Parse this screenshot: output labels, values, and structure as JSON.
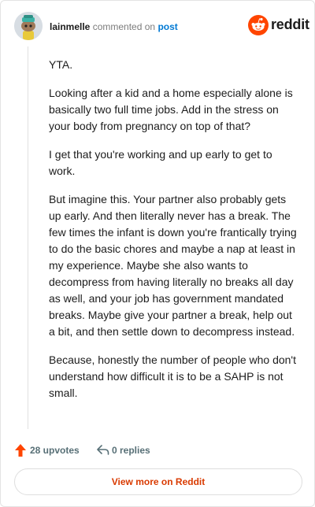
{
  "header": {
    "username": "lainmelle",
    "action_text": "commented on",
    "post_link": "post",
    "brand": "reddit"
  },
  "comment": {
    "paragraphs": [
      "YTA.",
      "Looking after a kid and a home especially alone is basically two full time jobs. Add in the stress on your body from pregnancy on top of that?",
      "I get that you're working and up early to get to work.",
      "But imagine this. Your partner also probably gets up early. And then literally never has a break. The few times the infant is down you're frantically trying to do the basic chores and maybe a nap at least in my experience. Maybe she also wants to decompress from having literally no breaks all day as well, and your job has government mandated breaks. Maybe give your partner a break, help out a bit, and then settle down to decompress instead.",
      "Because, honestly the number of people who don't understand how difficult it is to be a SAHP is not small."
    ]
  },
  "actions": {
    "upvotes": "28 upvotes",
    "replies": "0 replies"
  },
  "footer": {
    "view_more": "View more on Reddit"
  },
  "colors": {
    "brand_orange": "#ff4500",
    "link_blue": "#0079d3",
    "cta_red": "#d93a00",
    "muted": "#576f76"
  },
  "icons": {
    "avatar": "snoo-avatar",
    "brand": "reddit-logo-icon",
    "upvote": "upvote-arrow-icon",
    "reply": "reply-arrow-icon"
  }
}
